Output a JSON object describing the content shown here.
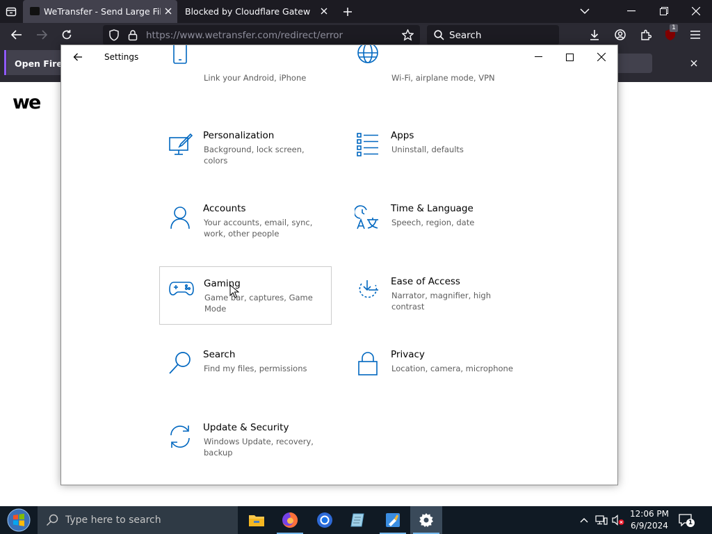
{
  "browser": {
    "tabs": [
      {
        "label": "WeTransfer - Send Large Files &",
        "active": true
      },
      {
        "label": "Blocked by Cloudflare Gateway",
        "active": false
      }
    ],
    "url": "https://www.wetransfer.com/redirect/error",
    "search_placeholder": "Search",
    "extension_badge": "1",
    "notification_text": "Open Firefo",
    "accent_color": "#9059ff"
  },
  "page": {
    "logo_text": "we"
  },
  "settings": {
    "title": "Settings",
    "accent_color": "#0067c0",
    "tiles": [
      {
        "title": "",
        "desc": "Link your Android, iPhone",
        "icon": "phone-icon"
      },
      {
        "title": "",
        "desc": "Wi-Fi, airplane mode, VPN",
        "icon": "globe-icon"
      },
      {
        "title": "Personalization",
        "desc": "Background, lock screen, colors",
        "icon": "personalization-icon"
      },
      {
        "title": "Apps",
        "desc": "Uninstall, defaults",
        "icon": "apps-list-icon"
      },
      {
        "title": "Accounts",
        "desc": "Your accounts, email, sync, work, other people",
        "icon": "person-icon"
      },
      {
        "title": "Time & Language",
        "desc": "Speech, region, date",
        "icon": "time-language-icon"
      },
      {
        "title": "Gaming",
        "desc": "Game bar, captures, Game Mode",
        "icon": "gamepad-icon"
      },
      {
        "title": "Ease of Access",
        "desc": "Narrator, magnifier, high contrast",
        "icon": "ease-of-access-icon"
      },
      {
        "title": "Search",
        "desc": "Find my files, permissions",
        "icon": "search-icon"
      },
      {
        "title": "Privacy",
        "desc": "Location, camera, microphone",
        "icon": "lock-icon"
      },
      {
        "title": "Update & Security",
        "desc": "Windows Update, recovery, backup",
        "icon": "update-icon"
      }
    ]
  },
  "taskbar": {
    "search_placeholder": "Type here to search",
    "time": "12:06 PM",
    "date": "6/9/2024",
    "notification_count": "1",
    "apps": [
      "file-explorer",
      "firefox",
      "chrome",
      "notepad",
      "paint",
      "settings"
    ]
  }
}
